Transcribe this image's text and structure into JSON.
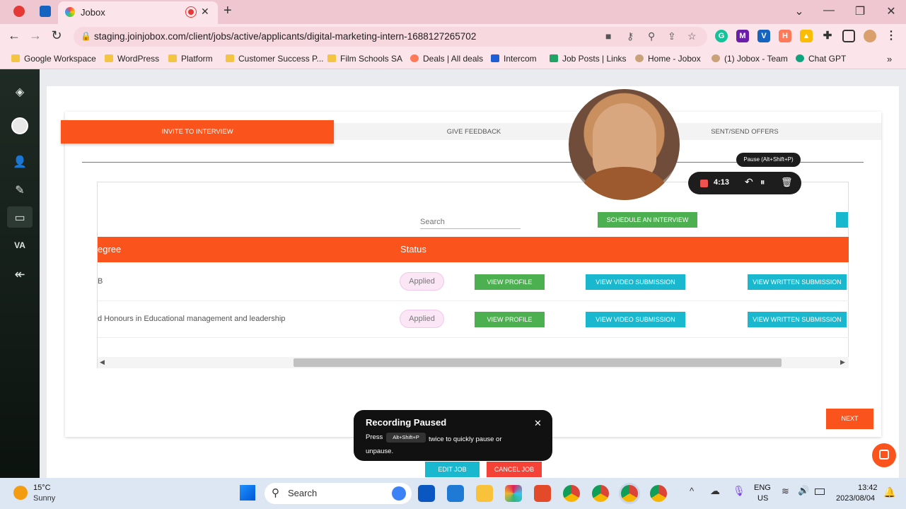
{
  "browser": {
    "tab_title": "Jobox",
    "url": "staging.joinjobox.com/client/jobs/active/applicants/digital-marketing-intern-1688127265702",
    "new_tab_label": "+",
    "close_tab_label": "✕"
  },
  "bookmarks": [
    {
      "label": "Google Workspace",
      "color": "#f4c542"
    },
    {
      "label": "WordPress",
      "color": "#f4c542"
    },
    {
      "label": "Platform",
      "color": "#f4c542"
    },
    {
      "label": "Customer Success P...",
      "color": "#f4c542"
    },
    {
      "label": "Film Schools SA",
      "color": "#f4c542"
    },
    {
      "label": "Deals | All deals",
      "color": "#ff7a59"
    },
    {
      "label": "Intercom",
      "color": "#1f5fd6"
    },
    {
      "label": "Job Posts | Links",
      "color": "#1fa463"
    },
    {
      "label": "Home - Jobox",
      "color": "#c9a27a"
    },
    {
      "label": "(1) Jobox - Team",
      "color": "#c9a27a"
    },
    {
      "label": "Chat GPT",
      "color": "#10a37f"
    }
  ],
  "left_rail": {
    "initials": "VA"
  },
  "steps": {
    "invite": "INVITE TO INTERVIEW",
    "feedback": "GIVE FEEDBACK",
    "offers": "SENT/SEND OFFERS"
  },
  "toolbar": {
    "search_placeholder": "Search",
    "schedule_label": "SCHEDULE AN INTERVIEW"
  },
  "table": {
    "columns": [
      "egree",
      "Status"
    ],
    "rows": [
      {
        "degree": "B",
        "status": "Applied",
        "view_profile": "VIEW PROFILE",
        "view_video": "VIEW VIDEO SUBMISSION",
        "view_written": "VIEW WRITTEN SUBMISSION"
      },
      {
        "degree": "d Honours in Educational management and leadership",
        "status": "Applied",
        "view_profile": "VIEW PROFILE",
        "view_video": "VIEW VIDEO SUBMISSION",
        "view_written": "VIEW WRITTEN SUBMISSION"
      }
    ]
  },
  "recorder": {
    "time": "4:13",
    "tooltip": "Pause (Alt+Shift+P)"
  },
  "toast": {
    "title": "Recording Paused",
    "press": "Press",
    "shortcut": "Alt+Shift+P",
    "message": "twice to quickly pause or unpause."
  },
  "actions": {
    "next": "NEXT",
    "edit_job": "EDIT JOB",
    "cancel_job": "CANCEL JOB"
  },
  "taskbar": {
    "temperature": "15°C",
    "weather": "Sunny",
    "search_label": "Search",
    "lang_top": "ENG",
    "lang_bottom": "US",
    "time": "13:42",
    "date": "2023/08/04"
  },
  "colors": {
    "brand_orange": "#fa541c",
    "action_green": "#4caf50",
    "action_cyan": "#1ab8cf"
  }
}
